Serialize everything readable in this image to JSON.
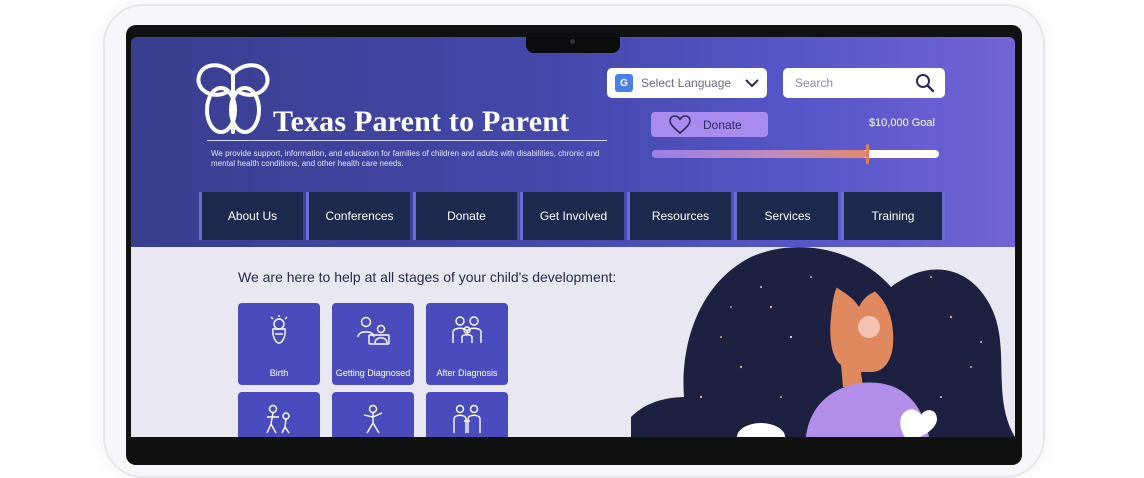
{
  "site": {
    "title": "Texas Parent to Parent",
    "tagline": "We provide support, information, and education for families of children and adults with disabilities, chronic and mental health conditions, and other health care needs."
  },
  "header": {
    "language_label": "Select Language",
    "search_placeholder": "Search",
    "donate_label": "Donate",
    "goal_label": "$10,000 Goal",
    "goal_progress": 0.75
  },
  "nav": {
    "items": [
      "About Us",
      "Conferences",
      "Donate",
      "Get Involved",
      "Resources",
      "Services",
      "Training"
    ]
  },
  "main": {
    "intro": "We are here to help at all stages of your child's development:",
    "tiles": [
      {
        "label": "Birth",
        "icon": "baby-icon"
      },
      {
        "label": "Getting Diagnosed",
        "icon": "consultation-icon"
      },
      {
        "label": "After Diagnosis",
        "icon": "family-icon"
      },
      {
        "label": "",
        "icon": "walking-child-icon"
      },
      {
        "label": "",
        "icon": "playing-child-icon"
      },
      {
        "label": "",
        "icon": "adults-icon"
      }
    ]
  },
  "colors": {
    "header_gradient_start": "#3a3e8f",
    "header_gradient_end": "#7363d6",
    "nav_bg": "#1e2a4d",
    "tile_bg": "#4a4bbd",
    "donate_bg": "#a98bf0"
  }
}
